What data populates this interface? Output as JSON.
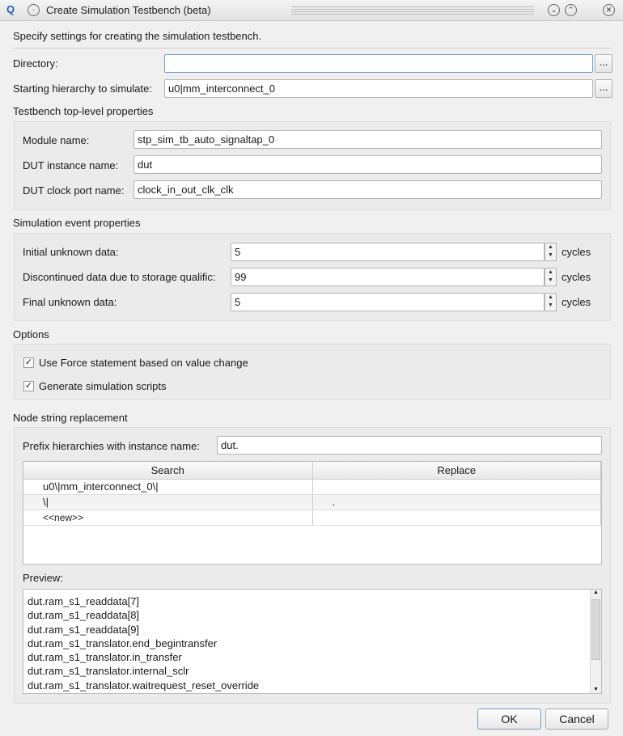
{
  "window": {
    "title": "Create Simulation Testbench (beta)",
    "icon": "app-logo-icon",
    "controls": [
      "minimize-icon",
      "maximize-icon",
      "close-icon"
    ]
  },
  "intro": "Specify settings for creating the simulation testbench.",
  "directory": {
    "label": "Directory:",
    "value": "",
    "browse": "..."
  },
  "hierarchy": {
    "label": "Starting hierarchy to simulate:",
    "value": "u0|mm_interconnect_0",
    "browse": "..."
  },
  "testbench": {
    "heading": "Testbench top-level properties",
    "module": {
      "label": "Module name:",
      "value": "stp_sim_tb_auto_signaltap_0"
    },
    "dut_instance": {
      "label": "DUT instance name:",
      "value": "dut"
    },
    "dut_clock": {
      "label": "DUT clock port name:",
      "value": "clock_in_out_clk_clk"
    }
  },
  "simulation": {
    "heading": "Simulation event properties",
    "unit": "cycles",
    "rows": [
      {
        "label": "Initial unknown data:",
        "value": "5"
      },
      {
        "label": "Discontinued data due to storage qualific:",
        "value": "99"
      },
      {
        "label": "Final unknown data:",
        "value": "5"
      }
    ]
  },
  "options": {
    "heading": "Options",
    "items": [
      {
        "label": "Use Force statement based on value change",
        "checked": true
      },
      {
        "label": "Generate simulation scripts",
        "checked": true
      }
    ]
  },
  "node": {
    "heading": "Node string replacement",
    "prefix": {
      "label": "Prefix hierarchies with instance name:",
      "value": "dut."
    },
    "columns": [
      "Search",
      "Replace"
    ],
    "rows": [
      [
        "u0\\|mm_interconnect_0\\|",
        ""
      ],
      [
        "\\|",
        "."
      ],
      [
        "<<new>>",
        ""
      ]
    ],
    "preview_label": "Preview:",
    "preview": [
      "dut.ram_s1_readdata[7]",
      "dut.ram_s1_readdata[8]",
      "dut.ram_s1_readdata[9]",
      "dut.ram_s1_translator.end_begintransfer",
      "dut.ram_s1_translator.in_transfer",
      "dut.ram_s1_translator.internal_sclr",
      "dut.ram_s1_translator.waitrequest_reset_override"
    ]
  },
  "buttons": {
    "ok": "OK",
    "cancel": "Cancel"
  }
}
